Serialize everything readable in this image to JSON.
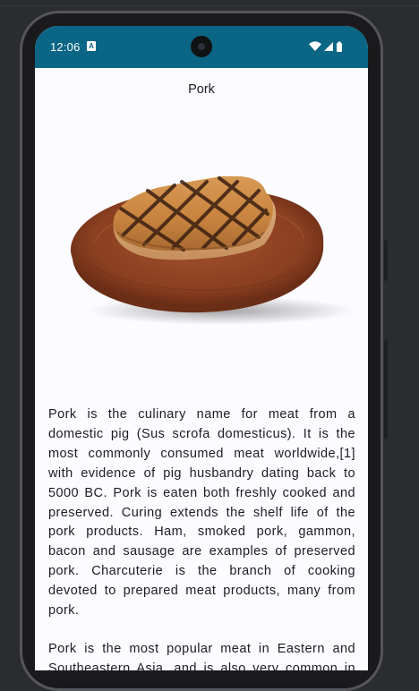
{
  "status_bar": {
    "time": "12:06",
    "notification_icon": "a-badge-icon",
    "wifi_icon": "wifi-icon",
    "signal_icon": "cell-signal-icon",
    "battery_icon": "battery-icon",
    "color": "#0b6585"
  },
  "screen": {
    "title": "Pork",
    "image": "pork-steak-on-wooden-board",
    "paragraphs": [
      "Pork is the culinary name for meat from a domestic pig (Sus scrofa domesticus). It is the most commonly consumed meat worldwide,[1] with evidence of pig husbandry dating back to 5000 BC. Pork is eaten both freshly cooked and preserved. Curing extends the shelf life of the pork products. Ham, smoked pork, gammon, bacon and sausage are examples of preserved pork. Charcuterie is the branch of cooking devoted to prepared meat products, many from pork.",
      "Pork is the most popular meat in Eastern and Southeastern Asia, and is also very common in the Western world, especially in Central Europe."
    ]
  }
}
